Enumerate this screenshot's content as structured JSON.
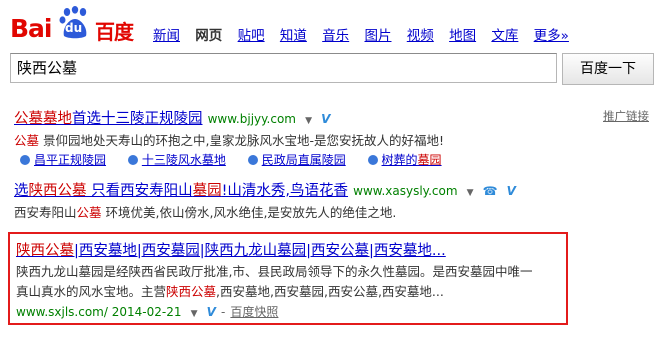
{
  "logo": {
    "part1": "Bai",
    "du": "du",
    "part2": "百度"
  },
  "nav": {
    "items": [
      "新闻",
      "网页",
      "贴吧",
      "知道",
      "音乐",
      "图片",
      "视频",
      "地图",
      "文库",
      "更多»"
    ],
    "active": "网页"
  },
  "search": {
    "query": "陕西公墓",
    "button_label": "百度一下"
  },
  "ad_link": "推广链接",
  "results": [
    {
      "title_em": "公墓墓地",
      "title_rest": "首选十三陵正规陵园",
      "url": "www.bjjyy.com",
      "abstract_em": "公墓",
      "abstract_rest": " 景仰园地处天寿山的环抱之中,皇家龙脉风水宝地-是您安抚故人的好福地!",
      "sitelinks": [
        {
          "text": "昌平正规陵园",
          "em": ""
        },
        {
          "text": "十三陵风水墓地",
          "em": ""
        },
        {
          "text": "民政局直属陵园",
          "em": ""
        },
        {
          "text": "树葬的",
          "em": "墓园"
        }
      ]
    },
    {
      "title_pre": "选",
      "title_em": "陕西公墓",
      "title_mid": " 只看西安寿阳山",
      "title_em2": "墓园",
      "title_rest": "!山清水秀,鸟语花香",
      "url": "www.xasysly.com",
      "abstract_pre": "西安寿阳山",
      "abstract_em": "公墓",
      "abstract_rest": " 环境优美,依山傍水,风水绝佳,是安放先人的绝佳之地."
    },
    {
      "title_em": "陕西公墓",
      "title_rest": "|西安墓地|西安墓园|陕西九龙山墓园|西安公墓|西安墓地...",
      "line1": "陕西九龙山墓园是经陕西省民政厅批准,市、县民政局领导下的永久性墓园。是西安墓园中唯一",
      "line2_pre": "真山真水的风水宝地。主营",
      "line2_em": "陕西公墓",
      "line2_rest": ",西安墓地,西安墓园,西安公墓,西安墓地...",
      "url": "www.sxjls.com/ 2014-02-21",
      "separator": "-",
      "snapshot": "百度快照"
    }
  ],
  "colors": {
    "brand": "#e10601",
    "link": "#0000cc",
    "url": "#008000",
    "highlight": "#c00000",
    "box": "#e31b1b"
  }
}
